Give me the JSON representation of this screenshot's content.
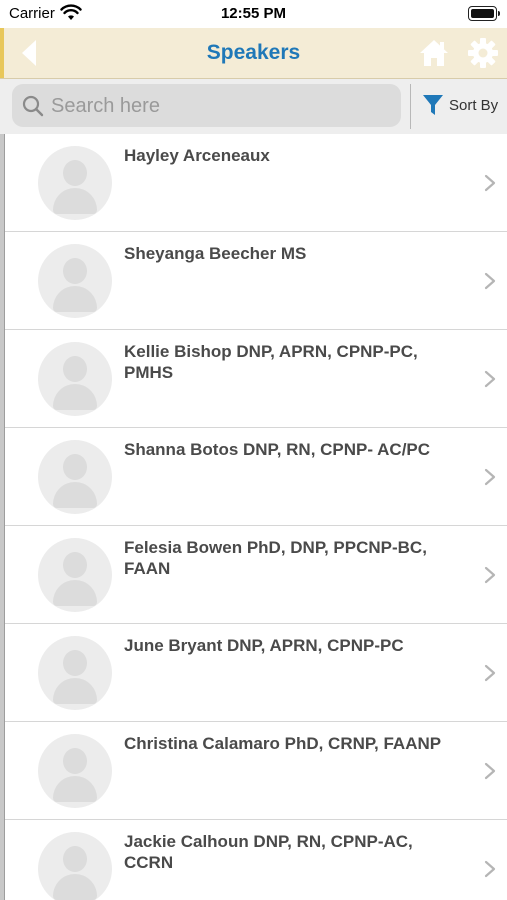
{
  "status_bar": {
    "carrier": "Carrier",
    "time": "12:55 PM"
  },
  "nav": {
    "title": "Speakers",
    "back_icon": "back-arrow-icon",
    "home_icon": "home-icon",
    "settings_icon": "gear-icon"
  },
  "search": {
    "placeholder": "Search here",
    "value": ""
  },
  "sort": {
    "label": "Sort By",
    "icon": "filter-icon"
  },
  "colors": {
    "nav_background": "#f4ecd6",
    "title": "#1f78b8",
    "accent_icon": "#1f78b8"
  },
  "speakers": [
    {
      "name": "Hayley Arceneaux"
    },
    {
      "name": "Sheyanga Beecher MS"
    },
    {
      "name": "Kellie Bishop DNP, APRN, CPNP-PC, PMHS"
    },
    {
      "name": "Shanna Botos DNP, RN, CPNP- AC/PC"
    },
    {
      "name": "Felesia Bowen PhD, DNP, PPCNP-BC, FAAN"
    },
    {
      "name": "June Bryant DNP, APRN, CPNP-PC"
    },
    {
      "name": "Christina Calamaro  PhD, CRNP, FAANP"
    },
    {
      "name": "Jackie Calhoun DNP, RN, CPNP-AC, CCRN"
    }
  ]
}
